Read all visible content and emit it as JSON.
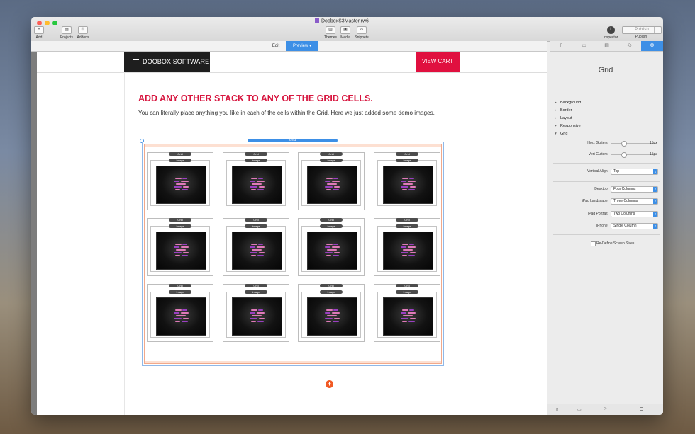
{
  "window": {
    "title": "DooboxS3Master.rw6",
    "traffic_lights": [
      "#fd5f57",
      "#febc2e",
      "#28c840"
    ]
  },
  "toolbar": {
    "left": [
      {
        "label": "Add",
        "glyph": "+"
      },
      {
        "label": "Projects",
        "glyph": "▤"
      },
      {
        "label": "Addons",
        "glyph": "⚙"
      }
    ],
    "center": [
      {
        "label": "Themes",
        "glyph": "▥"
      },
      {
        "label": "Media",
        "glyph": "▣"
      },
      {
        "label": "Snippets",
        "glyph": "‹›"
      }
    ],
    "right": {
      "inspector_label": "Inspector",
      "publish_label": "Publish",
      "publish_button": "Publish"
    }
  },
  "modes": {
    "edit": "Edit",
    "preview": "Preview ▾"
  },
  "inspector_tabs": [
    "▯",
    "▭",
    "▤",
    "◎",
    "⚙"
  ],
  "page": {
    "brand": "DOOBOX SOFTWARE",
    "cart": "VIEW CART",
    "heading": "ADD ANY OTHER STACK TO ANY OF THE GRID CELLS.",
    "paragraph": "You can literally place anything you like in each of the cells within the Grid. Here we just added some demo images.",
    "grid_label": "Grid",
    "cell_grid_label": "Grid",
    "cell_image_label": "Image",
    "add_glyph": "+"
  },
  "inspector": {
    "title": "Grid",
    "sections": [
      "Background",
      "Border",
      "Layout",
      "Responsive",
      "Grid"
    ],
    "horz_gutters": {
      "label": "Horz Gutters:",
      "value": "15px",
      "level": 0.27
    },
    "vert_gutters": {
      "label": "Vert Gutters:",
      "value": "15px",
      "level": 0.27
    },
    "vertical_align": {
      "label": "Vertical Align:",
      "value": "Top"
    },
    "desktop": {
      "label": "Desktop:",
      "value": "Four Columns"
    },
    "ipad_landscape": {
      "label": "iPad Landscape:",
      "value": "Three Columns"
    },
    "ipad_portrait": {
      "label": "iPad Portrait:",
      "value": "Two Columns"
    },
    "iphone": {
      "label": "iPhone:",
      "value": "Single Column"
    },
    "redefine": "Re-Define Screen Sizes",
    "footer_icons": [
      "▯",
      "▭",
      ">_",
      "☰"
    ]
  },
  "colors": {
    "accent_red": "#d7163f",
    "cart_red": "#e0103f",
    "selection_blue": "#3d8fe6",
    "add_orange": "#f15a24",
    "logo_pink": "#e07ab8",
    "logo_purple": "#9b3fc2"
  }
}
